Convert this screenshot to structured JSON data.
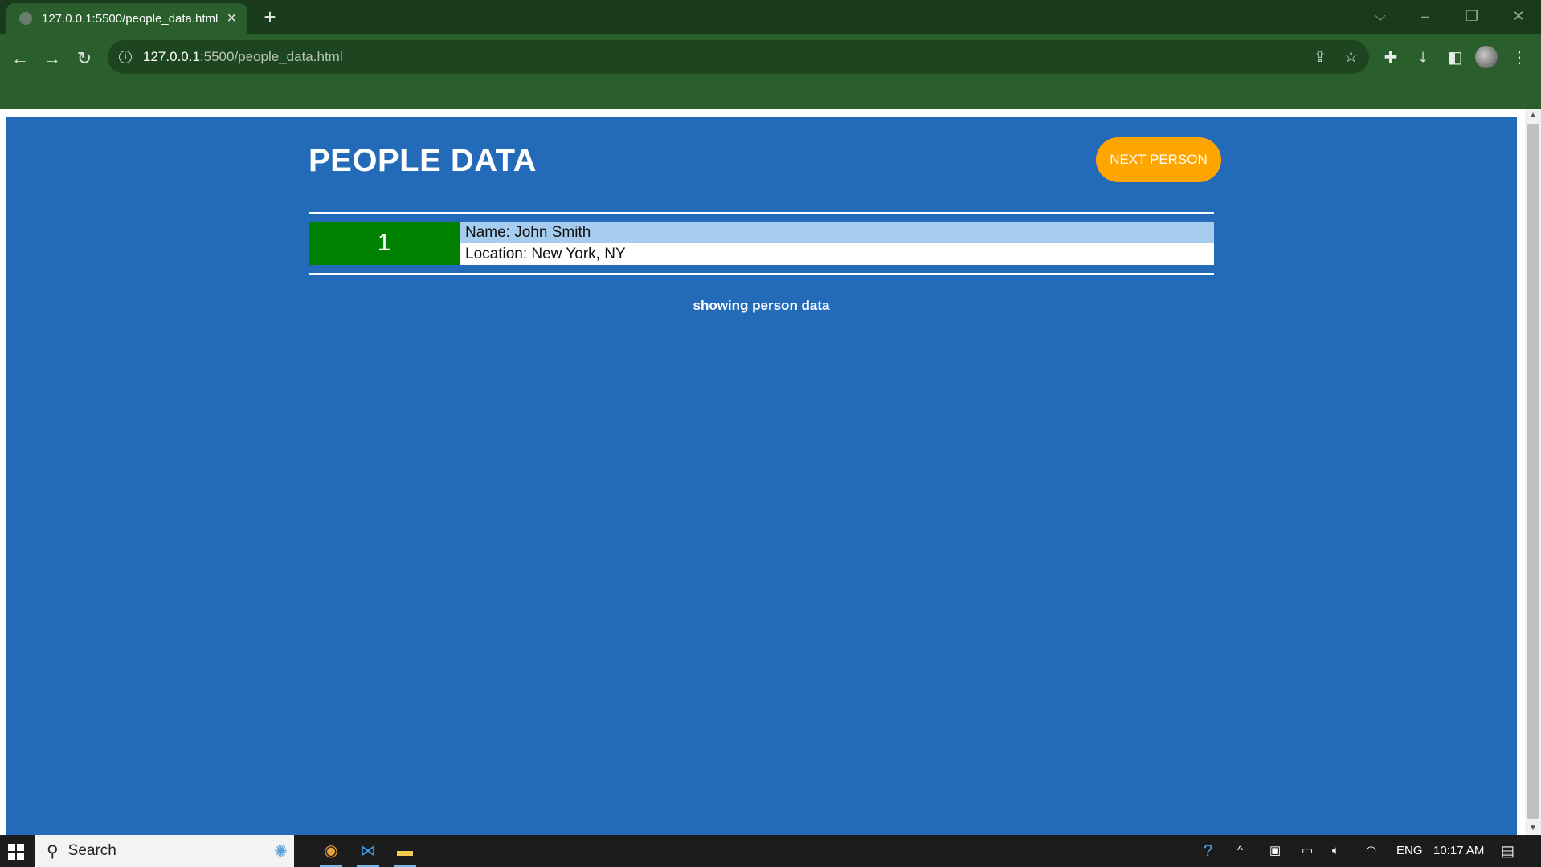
{
  "browser": {
    "tab_title": "127.0.0.1:5500/people_data.html",
    "new_tab_icon": "plus-icon",
    "url_host": "127.0.0.1",
    "url_rest": ":5500/people_data.html"
  },
  "page": {
    "title": "PEOPLE DATA",
    "next_button": "NEXT PERSON",
    "person": {
      "id": "1",
      "name": "Name: John Smith",
      "location": "Location: New York, NY"
    },
    "status": "showing person data"
  },
  "taskbar": {
    "search_label": "Search",
    "language": "ENG",
    "time": "10:17 AM"
  },
  "colors": {
    "page_background": "#236ab9",
    "button": "#ffa500",
    "id_cell": "#008000",
    "name_row": "#a6cdf0",
    "chrome": "#2a5e2c"
  }
}
